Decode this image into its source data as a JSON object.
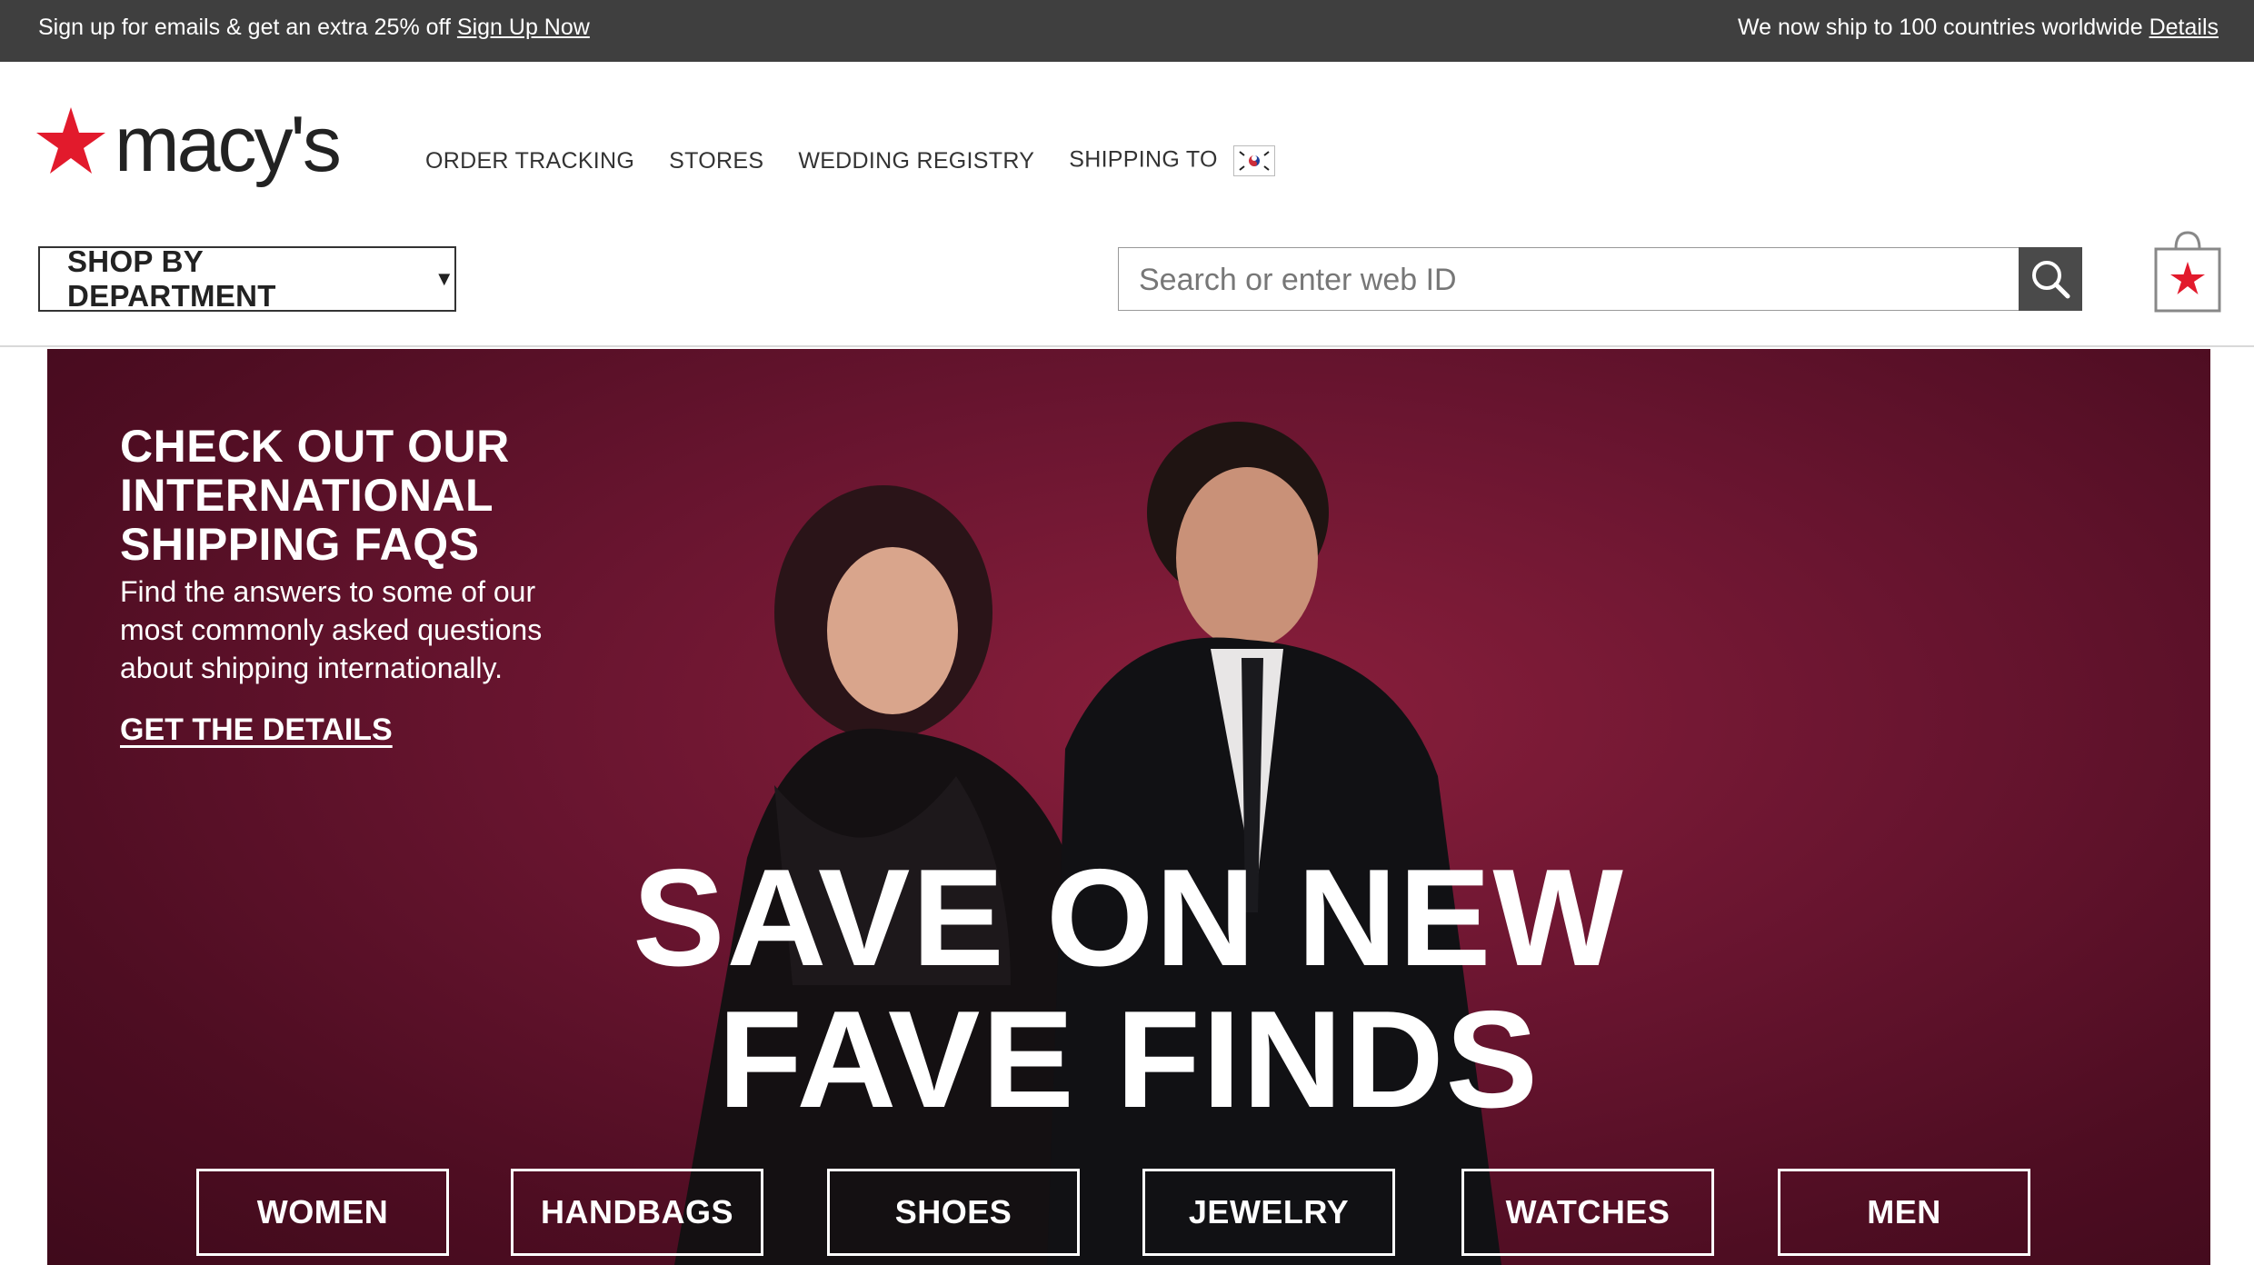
{
  "promo": {
    "left_text": "Sign up for emails & get an extra 25% off",
    "left_link": "Sign Up Now",
    "right_text": "We now ship to 100 countries worldwide",
    "right_link": "Details"
  },
  "brand": {
    "name": "macy's",
    "accent_color": "#e21a2c"
  },
  "util_nav": {
    "order_tracking": "ORDER TRACKING",
    "stores": "STORES",
    "wedding_registry": "WEDDING REGISTRY",
    "shipping_to": "SHIPPING TO"
  },
  "department_button": {
    "label": "SHOP BY DEPARTMENT",
    "caret": "▼"
  },
  "search": {
    "placeholder": "Search or enter web ID",
    "value": ""
  },
  "hero": {
    "faq_title": "CHECK OUT OUR INTERNATIONAL SHIPPING FAQS",
    "faq_body": "Find the answers to some of our most commonly asked questions about shipping internationally.",
    "faq_cta": "GET THE DETAILS",
    "headline_line1": "SAVE ON NEW",
    "headline_line2": "FAVE FINDS",
    "background_color": "#6a1530",
    "categories": [
      "WOMEN",
      "HANDBAGS",
      "SHOES",
      "JEWELRY",
      "WATCHES",
      "MEN"
    ]
  }
}
